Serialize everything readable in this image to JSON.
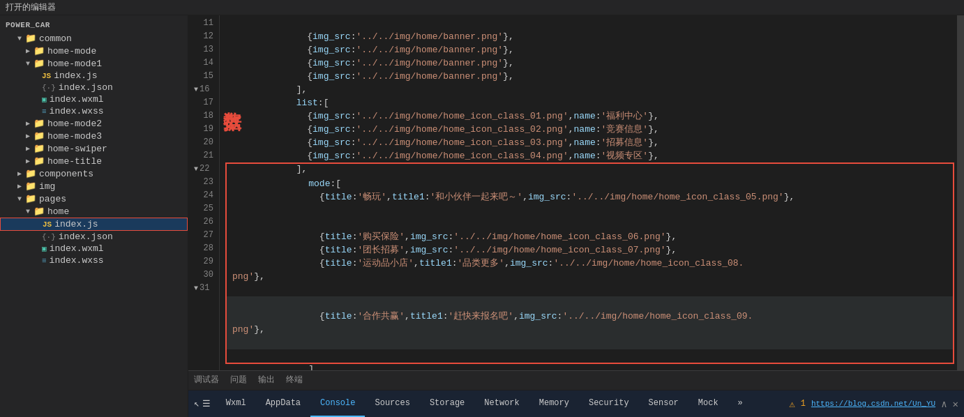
{
  "topbar": {
    "title": "打开的编辑器"
  },
  "sidebar": {
    "sections": [
      {
        "name": "POWER_CAR",
        "items": [
          {
            "level": 1,
            "type": "folder",
            "label": "common",
            "expanded": true,
            "arrow": "▼"
          },
          {
            "level": 2,
            "type": "folder",
            "label": "home-mode",
            "expanded": false,
            "arrow": "▶"
          },
          {
            "level": 2,
            "type": "folder",
            "label": "home-mode1",
            "expanded": true,
            "arrow": "▼"
          },
          {
            "level": 3,
            "type": "js",
            "label": "index.js",
            "icon": "js"
          },
          {
            "level": 3,
            "type": "json",
            "label": "index.json",
            "icon": "json"
          },
          {
            "level": 3,
            "type": "wxml",
            "label": "index.wxml",
            "icon": "wxml"
          },
          {
            "level": 3,
            "type": "wxss",
            "label": "index.wxss",
            "icon": "wxss"
          },
          {
            "level": 2,
            "type": "folder",
            "label": "home-mode2",
            "expanded": false,
            "arrow": "▶"
          },
          {
            "level": 2,
            "type": "folder",
            "label": "home-mode3",
            "expanded": false,
            "arrow": "▶"
          },
          {
            "level": 2,
            "type": "folder",
            "label": "home-swiper",
            "expanded": false,
            "arrow": "▶"
          },
          {
            "level": 2,
            "type": "folder",
            "label": "home-title",
            "expanded": false,
            "arrow": "▶"
          },
          {
            "level": 1,
            "type": "folder",
            "label": "components",
            "expanded": false,
            "arrow": "▶"
          },
          {
            "level": 1,
            "type": "folder",
            "label": "img",
            "expanded": false,
            "arrow": "▶"
          },
          {
            "level": 1,
            "type": "folder",
            "label": "pages",
            "expanded": true,
            "arrow": "▼"
          },
          {
            "level": 2,
            "type": "folder",
            "label": "home",
            "expanded": true,
            "arrow": "▼"
          },
          {
            "level": 3,
            "type": "js",
            "label": "index.js",
            "icon": "js",
            "active": true
          },
          {
            "level": 3,
            "type": "json",
            "label": "index.json",
            "icon": "json"
          },
          {
            "level": 3,
            "type": "wxml",
            "label": "index.wxml",
            "icon": "wxml"
          },
          {
            "level": 3,
            "type": "wxss",
            "label": "index.wxss",
            "icon": "wxss"
          }
        ]
      }
    ]
  },
  "editor": {
    "data_label": "数据",
    "lines": [
      {
        "num": 11,
        "content": "    {img_src:'../../img/home/banner.png'},",
        "type": "normal"
      },
      {
        "num": 12,
        "content": "    {img_src:'../../img/home/banner.png'},",
        "type": "normal"
      },
      {
        "num": 13,
        "content": "    {img_src:'../../img/home/banner.png'},",
        "type": "normal"
      },
      {
        "num": 14,
        "content": "    {img_src:'../../img/home/banner.png'},",
        "type": "normal"
      },
      {
        "num": 15,
        "content": "  ],",
        "type": "normal"
      },
      {
        "num": 16,
        "content": "  list:[",
        "type": "normal",
        "arrow": "▼"
      },
      {
        "num": 17,
        "content": "    {img_src:'../../img/home/home_icon_class_01.png',name:'福利中心'},",
        "type": "normal"
      },
      {
        "num": 18,
        "content": "    {img_src:'../../img/home/home_icon_class_02.png',name:'竞赛信息'},",
        "type": "normal"
      },
      {
        "num": 19,
        "content": "    {img_src:'../../img/home/home_icon_class_03.png',name:'招募信息'},",
        "type": "normal"
      },
      {
        "num": 20,
        "content": "    {img_src:'../../img/home/home_icon_class_04.png',name:'视频专区'},",
        "type": "normal"
      },
      {
        "num": 21,
        "content": "  ],",
        "type": "normal"
      },
      {
        "num": 22,
        "content": "  mode:[",
        "type": "mode-start",
        "arrow": "▼"
      },
      {
        "num": 23,
        "content": "    {title:'畅玩',title1:'和小伙伴一起来吧～',img_src:'../../img/home/home_icon_class_05.png'},",
        "type": "mode"
      },
      {
        "num": 24,
        "content": "    {title:'购买保险',img_src:'../../img/home/home_icon_class_06.png'},",
        "type": "mode"
      },
      {
        "num": 25,
        "content": "    {title:'团长招募',img_src:'../../img/home/home_icon_class_07.png'},",
        "type": "mode"
      },
      {
        "num": 26,
        "content": "    {title:'运动品小店',title1:'品类更多',img_src:'../../img/home/home_icon_class_08.png'},",
        "type": "mode"
      },
      {
        "num": 27,
        "content": "    {title:'合作共赢',title1:'赶快来报名吧',img_src:'../../img/home/home_icon_class_09.png'},",
        "type": "mode-current"
      },
      {
        "num": 28,
        "content": "  ],",
        "type": "mode-end"
      },
      {
        "num": 29,
        "content": "},",
        "type": "normal"
      },
      {
        "num": 30,
        "content": "",
        "type": "normal"
      },
      {
        "num": 31,
        "content": "/**",
        "type": "normal",
        "arrow": "▼"
      }
    ]
  },
  "panel": {
    "tabs": [
      {
        "label": "调试器",
        "active": false
      },
      {
        "label": "问题",
        "active": false
      },
      {
        "label": "输出",
        "active": false
      },
      {
        "label": "终端",
        "active": false
      }
    ]
  },
  "devtools": {
    "icons_left": [
      "↖",
      "☰"
    ],
    "buttons": [
      {
        "label": "Wxml",
        "active": false
      },
      {
        "label": "AppData",
        "active": false
      },
      {
        "label": "Console",
        "active": true
      },
      {
        "label": "Sources",
        "active": false
      },
      {
        "label": "Storage",
        "active": false
      },
      {
        "label": "Network",
        "active": false
      },
      {
        "label": "Memory",
        "active": false
      },
      {
        "label": "Security",
        "active": false
      },
      {
        "label": "Sensor",
        "active": false
      },
      {
        "label": "Mock",
        "active": false
      }
    ],
    "more_btn": "»",
    "url": "https://blog.csdn.net/Un_YU",
    "warning_icon": "⚠",
    "warning_count": "1",
    "close_btn": "✕",
    "collapse_btn": "∧"
  }
}
